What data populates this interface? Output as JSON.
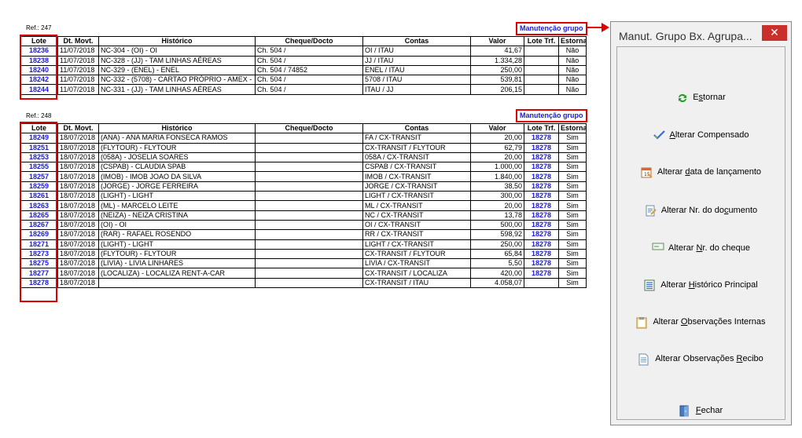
{
  "group1": {
    "ref": "Ref.: 247",
    "manut_label": "Manutenção grupo",
    "headers": [
      "Lote",
      "Dt. Movt.",
      "Histórico",
      "Cheque/Docto",
      "Contas",
      "Valor",
      "Lote Trf.",
      "Estornado"
    ],
    "rows": [
      [
        "18236",
        "11/07/2018",
        "NC-304 - (OI) - OI",
        "Ch. 504 /",
        "OI / ITAU",
        "41,67",
        "",
        "Não"
      ],
      [
        "18238",
        "11/07/2018",
        "NC-328 - (JJ) - TAM LINHAS AÉREAS",
        "Ch. 504 /",
        "JJ / ITAU",
        "1.334,28",
        "",
        "Não"
      ],
      [
        "18240",
        "11/07/2018",
        "NC-329 - (ENEL) - ENEL",
        "Ch. 504 /  74852",
        "ENEL / ITAU",
        "250,00",
        "",
        "Não"
      ],
      [
        "18242",
        "11/07/2018",
        "NC-332 - (5708) - CARTAO PRÓPRIO - AMEX -",
        "Ch. 504 /",
        "5708 / ITAU",
        "539,81",
        "",
        "Não"
      ],
      [
        "18244",
        "11/07/2018",
        "NC-331 - (JJ) - TAM LINHAS AÉREAS",
        "Ch. 504 /",
        "ITAU / JJ",
        "206,15",
        "",
        "Não"
      ]
    ]
  },
  "group2": {
    "ref": "Ref.: 248",
    "manut_label": "Manutenção grupo",
    "headers": [
      "Lote",
      "Dt. Movt.",
      "Histórico",
      "Cheque/Docto",
      "Contas",
      "Valor",
      "Lote Trf.",
      "Estornado"
    ],
    "rows": [
      [
        "18249",
        "18/07/2018",
        "(ANA) - ANA MARIA FONSECA RAMOS",
        "",
        "FA / CX-TRANSIT",
        "20,00",
        "18278",
        "Sim"
      ],
      [
        "18251",
        "18/07/2018",
        "(FLYTOUR) - FLYTOUR",
        "",
        "CX-TRANSIT / FLYTOUR",
        "62,79",
        "18278",
        "Sim"
      ],
      [
        "18253",
        "18/07/2018",
        "(058A) - JOSELIA SOARES",
        "",
        "058A / CX-TRANSIT",
        "20,00",
        "18278",
        "Sim"
      ],
      [
        "18255",
        "18/07/2018",
        "(CSPAB) - CLAUDIA SPAB",
        "",
        "CSPAB / CX-TRANSIT",
        "1.000,00",
        "18278",
        "Sim"
      ],
      [
        "18257",
        "18/07/2018",
        "(IMOB) - IMOB JOAO DA SILVA",
        "",
        "IMOB / CX-TRANSIT",
        "1.840,00",
        "18278",
        "Sim"
      ],
      [
        "18259",
        "18/07/2018",
        "(JORGE) - JORGE FERREIRA",
        "",
        "JORGE / CX-TRANSIT",
        "38,50",
        "18278",
        "Sim"
      ],
      [
        "18261",
        "18/07/2018",
        "(LIGHT) - LIGHT",
        "",
        "LIGHT / CX-TRANSIT",
        "300,00",
        "18278",
        "Sim"
      ],
      [
        "18263",
        "18/07/2018",
        "(ML) - MARCELO LEITE",
        "",
        "ML / CX-TRANSIT",
        "20,00",
        "18278",
        "Sim"
      ],
      [
        "18265",
        "18/07/2018",
        "(NEIZA) - NEIZA CRISTINA",
        "",
        "NC / CX-TRANSIT",
        "13,78",
        "18278",
        "Sim"
      ],
      [
        "18267",
        "18/07/2018",
        "(OI) - OI",
        "",
        "OI / CX-TRANSIT",
        "500,00",
        "18278",
        "Sim"
      ],
      [
        "18269",
        "18/07/2018",
        "(RAR) - RAFAEL ROSENDO",
        "",
        "RR / CX-TRANSIT",
        "598,92",
        "18278",
        "Sim"
      ],
      [
        "18271",
        "18/07/2018",
        "(LIGHT) - LIGHT",
        "",
        "LIGHT / CX-TRANSIT",
        "250,00",
        "18278",
        "Sim"
      ],
      [
        "18273",
        "18/07/2018",
        "(FLYTOUR) - FLYTOUR",
        "",
        "CX-TRANSIT / FLYTOUR",
        "65,84",
        "18278",
        "Sim"
      ],
      [
        "18275",
        "18/07/2018",
        "(LIVIA) - LIVIA LINHARES",
        "",
        "LIVIA / CX-TRANSIT",
        "5,50",
        "18278",
        "Sim"
      ],
      [
        "18277",
        "18/07/2018",
        "(LOCALIZA) - LOCALIZA RENT-A-CAR",
        "",
        "CX-TRANSIT / LOCALIZA",
        "420,00",
        "18278",
        "Sim"
      ],
      [
        "18278",
        "18/07/2018",
        "",
        "",
        "CX-TRANSIT / ITAU",
        "4.058,07",
        "",
        "Sim"
      ]
    ]
  },
  "panel": {
    "title": "Manut. Grupo Bx. Agrupa...",
    "close": "✕",
    "buttons": [
      {
        "name": "estornar",
        "pre": "E",
        "ul": "s",
        "post": "tornar",
        "icon": "refresh-icon"
      },
      {
        "name": "alterar-compensado",
        "pre": "",
        "ul": "A",
        "post": "lterar Compensado",
        "icon": "check-icon"
      },
      {
        "name": "alterar-data-lancamento",
        "pre": "Alterar ",
        "ul": "d",
        "post": "ata de lançamento",
        "icon": "calendar-icon"
      },
      {
        "name": "alterar-nr-documento",
        "pre": "Alterar Nr. do do",
        "ul": "c",
        "post": "umento",
        "icon": "document-edit-icon"
      },
      {
        "name": "alterar-nr-cheque",
        "pre": "Alterar ",
        "ul": "N",
        "post": "r. do cheque",
        "icon": "cheque-icon"
      },
      {
        "name": "alterar-historico-principal",
        "pre": "Alterar ",
        "ul": "H",
        "post": "istórico Principal",
        "icon": "list-icon"
      },
      {
        "name": "alterar-observacoes-internas",
        "pre": "Alterar ",
        "ul": "O",
        "post": "bservações Internas",
        "icon": "clipboard-icon"
      },
      {
        "name": "alterar-observacoes-recibo",
        "pre": "Alterar Observações ",
        "ul": "R",
        "post": "ecibo",
        "icon": "page-icon"
      },
      {
        "name": "fechar",
        "pre": "",
        "ul": "F",
        "post": "echar",
        "icon": "door-icon"
      }
    ]
  }
}
